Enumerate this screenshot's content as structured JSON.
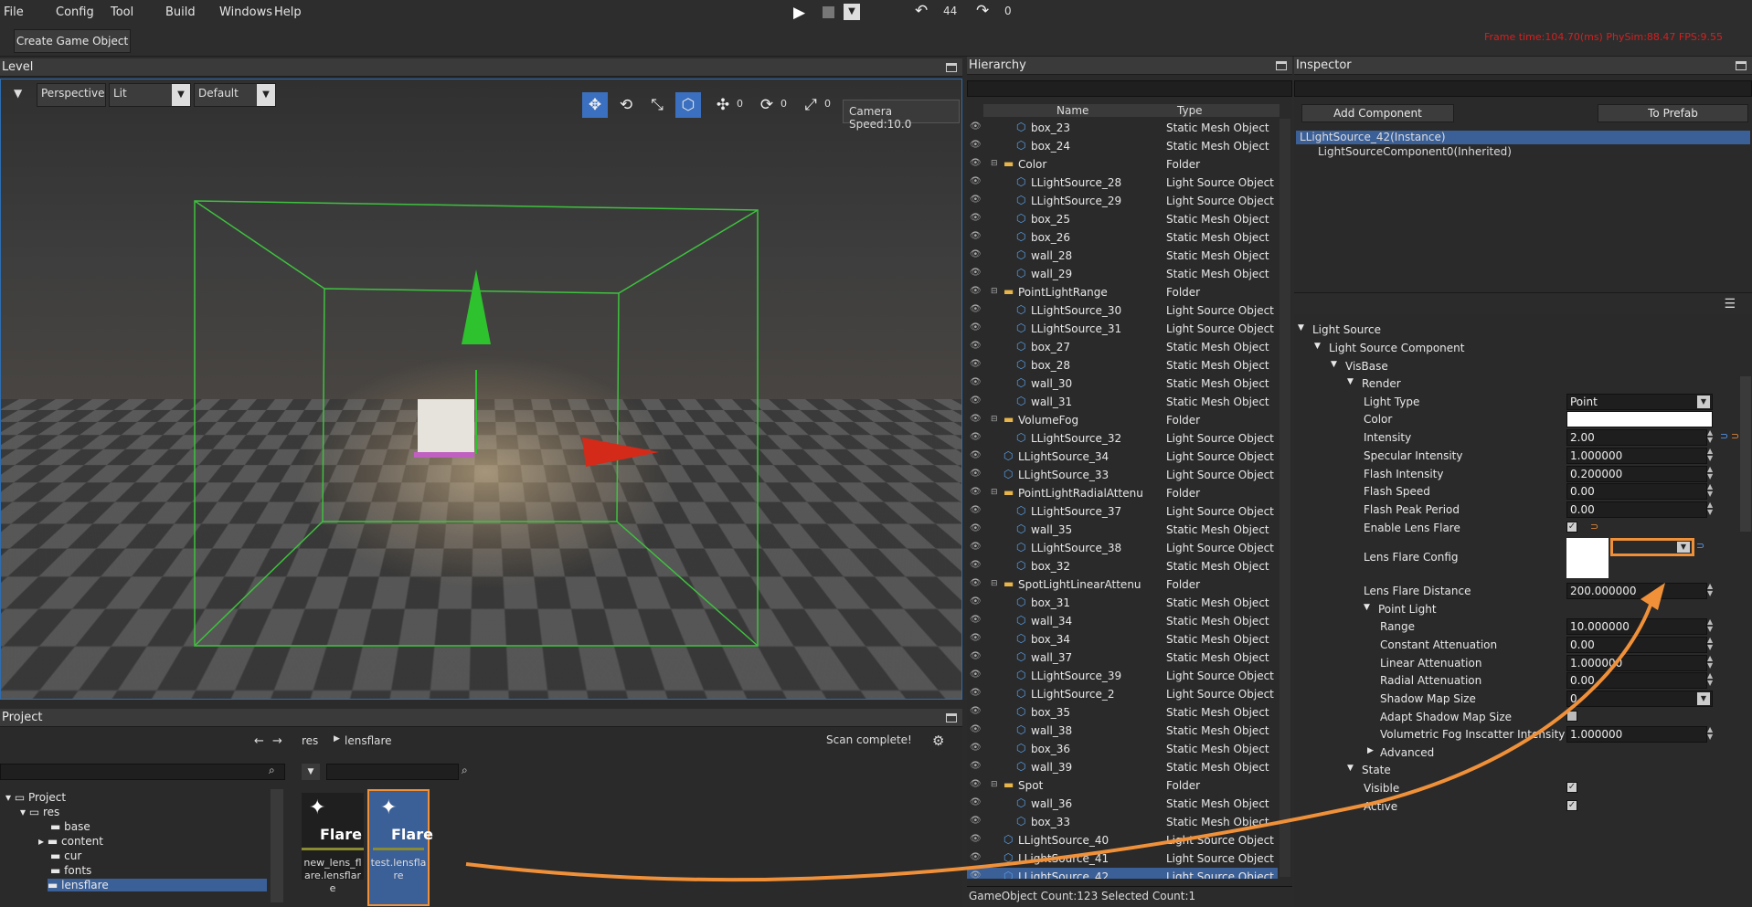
{
  "menu": [
    "File",
    "Config",
    "Tool",
    "Build",
    "Windows",
    "Help"
  ],
  "toolbar": {
    "create_button": "Create Game Object",
    "undo_count": "44",
    "redo_count": "0"
  },
  "stats": {
    "text": "Frame time:104.70(ms)  PhySim:88.47  FPS:9.55"
  },
  "level": {
    "title": "Level",
    "perspective": "Perspective",
    "shading": "Lit",
    "layout": "Default",
    "move_count": "0",
    "rotate_count": "0",
    "scale_count": "0",
    "camera_speed": "Camera Speed:10.0"
  },
  "hierarchy": {
    "title": "Hierarchy",
    "col_name": "Name",
    "col_type": "Type",
    "rows": [
      {
        "name": "box_23",
        "type": "Static Mesh Object",
        "indent": 2,
        "kind": "mesh"
      },
      {
        "name": "box_24",
        "type": "Static Mesh Object",
        "indent": 2,
        "kind": "mesh"
      },
      {
        "name": "Color",
        "type": "Folder",
        "indent": 1,
        "kind": "folder"
      },
      {
        "name": "LLightSource_28",
        "type": "Light Source Object",
        "indent": 2,
        "kind": "mesh"
      },
      {
        "name": "LLightSource_29",
        "type": "Light Source Object",
        "indent": 2,
        "kind": "mesh"
      },
      {
        "name": "box_25",
        "type": "Static Mesh Object",
        "indent": 2,
        "kind": "mesh"
      },
      {
        "name": "box_26",
        "type": "Static Mesh Object",
        "indent": 2,
        "kind": "mesh"
      },
      {
        "name": "wall_28",
        "type": "Static Mesh Object",
        "indent": 2,
        "kind": "mesh"
      },
      {
        "name": "wall_29",
        "type": "Static Mesh Object",
        "indent": 2,
        "kind": "mesh"
      },
      {
        "name": "PointLightRange",
        "type": "Folder",
        "indent": 1,
        "kind": "folder"
      },
      {
        "name": "LLightSource_30",
        "type": "Light Source Object",
        "indent": 2,
        "kind": "mesh"
      },
      {
        "name": "LLightSource_31",
        "type": "Light Source Object",
        "indent": 2,
        "kind": "mesh"
      },
      {
        "name": "box_27",
        "type": "Static Mesh Object",
        "indent": 2,
        "kind": "mesh"
      },
      {
        "name": "box_28",
        "type": "Static Mesh Object",
        "indent": 2,
        "kind": "mesh"
      },
      {
        "name": "wall_30",
        "type": "Static Mesh Object",
        "indent": 2,
        "kind": "mesh"
      },
      {
        "name": "wall_31",
        "type": "Static Mesh Object",
        "indent": 2,
        "kind": "mesh"
      },
      {
        "name": "VolumeFog",
        "type": "Folder",
        "indent": 1,
        "kind": "folder"
      },
      {
        "name": "LLightSource_32",
        "type": "Light Source Object",
        "indent": 2,
        "kind": "mesh"
      },
      {
        "name": "LLightSource_34",
        "type": "Light Source Object",
        "indent": 1,
        "kind": "mesh"
      },
      {
        "name": "LLightSource_33",
        "type": "Light Source Object",
        "indent": 1,
        "kind": "mesh"
      },
      {
        "name": "PointLightRadialAttenu",
        "type": "Folder",
        "indent": 1,
        "kind": "folder"
      },
      {
        "name": "LLightSource_37",
        "type": "Light Source Object",
        "indent": 2,
        "kind": "mesh"
      },
      {
        "name": "wall_35",
        "type": "Static Mesh Object",
        "indent": 2,
        "kind": "mesh"
      },
      {
        "name": "LLightSource_38",
        "type": "Light Source Object",
        "indent": 2,
        "kind": "mesh"
      },
      {
        "name": "box_32",
        "type": "Static Mesh Object",
        "indent": 2,
        "kind": "mesh"
      },
      {
        "name": "SpotLightLinearAttenu",
        "type": "Folder",
        "indent": 1,
        "kind": "folder"
      },
      {
        "name": "box_31",
        "type": "Static Mesh Object",
        "indent": 2,
        "kind": "mesh"
      },
      {
        "name": "wall_34",
        "type": "Static Mesh Object",
        "indent": 2,
        "kind": "mesh"
      },
      {
        "name": "box_34",
        "type": "Static Mesh Object",
        "indent": 2,
        "kind": "mesh"
      },
      {
        "name": "wall_37",
        "type": "Static Mesh Object",
        "indent": 2,
        "kind": "mesh"
      },
      {
        "name": "LLightSource_39",
        "type": "Light Source Object",
        "indent": 2,
        "kind": "mesh"
      },
      {
        "name": "LLightSource_2",
        "type": "Light Source Object",
        "indent": 2,
        "kind": "mesh"
      },
      {
        "name": "box_35",
        "type": "Static Mesh Object",
        "indent": 2,
        "kind": "mesh"
      },
      {
        "name": "wall_38",
        "type": "Static Mesh Object",
        "indent": 2,
        "kind": "mesh"
      },
      {
        "name": "box_36",
        "type": "Static Mesh Object",
        "indent": 2,
        "kind": "mesh"
      },
      {
        "name": "wall_39",
        "type": "Static Mesh Object",
        "indent": 2,
        "kind": "mesh"
      },
      {
        "name": "Spot",
        "type": "Folder",
        "indent": 1,
        "kind": "folder"
      },
      {
        "name": "wall_36",
        "type": "Static Mesh Object",
        "indent": 2,
        "kind": "mesh"
      },
      {
        "name": "box_33",
        "type": "Static Mesh Object",
        "indent": 2,
        "kind": "mesh"
      },
      {
        "name": "LLightSource_40",
        "type": "Light Source Object",
        "indent": 1,
        "kind": "mesh"
      },
      {
        "name": "LLightSource_41",
        "type": "Light Source Object",
        "indent": 1,
        "kind": "mesh"
      },
      {
        "name": "LLightSource_42",
        "type": "Light Source Object",
        "indent": 1,
        "kind": "mesh",
        "selected": true
      }
    ],
    "status": "GameObject Count:123    Selected Count:1"
  },
  "inspector": {
    "title": "Inspector",
    "add_component": "Add Component",
    "to_prefab": "To Prefab",
    "instance": "LLightSource_42(Instance)",
    "component": "LightSourceComponent0(Inherited)",
    "sec_light_source": "Light Source",
    "sec_component": "Light Source Component",
    "sec_visbase": "VisBase",
    "sec_render": "Render",
    "props": {
      "light_type": {
        "label": "Light Type",
        "value": "Point"
      },
      "color": {
        "label": "Color"
      },
      "intensity": {
        "label": "Intensity",
        "value": "2.00"
      },
      "specular": {
        "label": "Specular Intensity",
        "value": "1.000000"
      },
      "flash_intensity": {
        "label": "Flash Intensity",
        "value": "0.200000"
      },
      "flash_speed": {
        "label": "Flash Speed",
        "value": "0.00"
      },
      "flash_peak": {
        "label": "Flash Peak Period",
        "value": "0.00"
      },
      "enable_flare": {
        "label": "Enable Lens Flare"
      },
      "flare_config": {
        "label": "Lens Flare Config"
      },
      "flare_distance": {
        "label": "Lens Flare Distance",
        "value": "200.000000"
      },
      "point_light": {
        "label": "Point Light"
      },
      "range": {
        "label": "Range",
        "value": "10.000000"
      },
      "const_att": {
        "label": "Constant Attenuation",
        "value": "0.00"
      },
      "linear_att": {
        "label": "Linear Attenuation",
        "value": "1.000000"
      },
      "radial_att": {
        "label": "Radial Attenuation",
        "value": "0.00"
      },
      "shadow_map": {
        "label": "Shadow Map Size",
        "value": "0"
      },
      "adapt_shadow": {
        "label": "Adapt Shadow Map Size"
      },
      "vol_fog": {
        "label": "Volumetric Fog Inscatter Intensity",
        "value": "1.000000"
      },
      "advanced": {
        "label": "Advanced"
      },
      "state": {
        "label": "State"
      },
      "visible": {
        "label": "Visible"
      },
      "active": {
        "label": "Active"
      }
    }
  },
  "project": {
    "title": "Project",
    "breadcrumb_res": "res",
    "breadcrumb_folder": "lensflare",
    "scan_status": "Scan complete!",
    "tree": [
      "Project",
      "res",
      "base",
      "content",
      "cur",
      "fonts",
      "lensflare"
    ],
    "assets": [
      {
        "badge": "Flare",
        "name": "new_lens_flare.lensflare"
      },
      {
        "badge": "Flare",
        "name": "test.lensflare"
      }
    ]
  },
  "colors": {
    "accent": "#2e6db0",
    "selection": "#3b5f97",
    "highlight": "#f0913a",
    "stats": "#d42020"
  }
}
